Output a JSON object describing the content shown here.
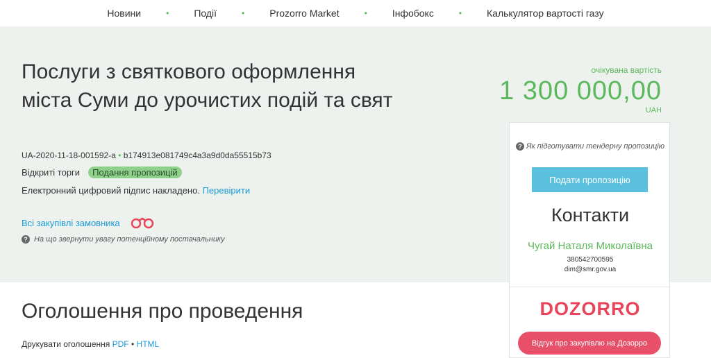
{
  "nav": {
    "items": [
      "Новини",
      "Події",
      "Prozorro Market",
      "Інфобокс",
      "Калькулятор вартості газу"
    ],
    "separator": "•"
  },
  "tender": {
    "title": "Послуги з святкового оформлення міста Суми до урочистих подій та свят",
    "id": "UA-2020-11-18-001592-a",
    "id_separator": "•",
    "hash": "b174913e081749c4a3a9d0da55515b73",
    "procedure": "Відкриті торги",
    "status": "Подання пропозицій",
    "signature_text": "Електронний цифровий підпис накладено.",
    "signature_link": "Перевірити",
    "all_purchases_link": "Всі закупівлі замовника",
    "hint": "На що звернути увагу потенційному постачальнику"
  },
  "expected": {
    "label": "очікувана вартість",
    "value": "1 300 000,00",
    "currency": "UAH"
  },
  "sidebar": {
    "how_to": "Як підготувати тендерну пропозицію",
    "submit_button": "Подати пропозицію",
    "contacts_heading": "Контакти",
    "contact_name": "Чугай Наталя Миколаївна",
    "contact_phone": "380542700595",
    "contact_email": "dim@smr.gov.ua",
    "dozorro_logo": "DOZORRO",
    "dozorro_button": "Відгук про закупівлю на Дозорро"
  },
  "announcement": {
    "heading": "Оголошення про проведення",
    "print_label": "Друкувати оголошення",
    "pdf": "PDF",
    "separator": "•",
    "html": "HTML"
  },
  "colors": {
    "accent_green": "#5cb85c",
    "link_blue": "#1a9ad6",
    "dozorro_red": "#e8445a"
  }
}
